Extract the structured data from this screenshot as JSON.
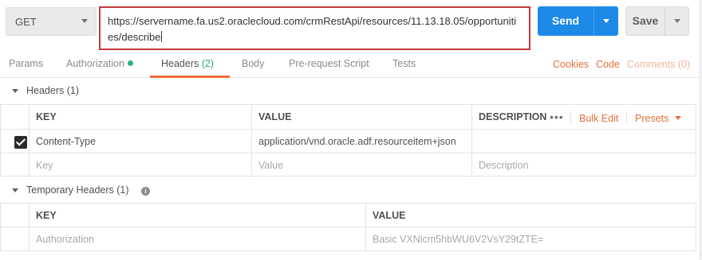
{
  "request": {
    "method": "GET",
    "url": "https://servername.fa.us2.oraclecloud.com/crmRestApi/resources/11.13.18.05/opportunities/describe",
    "send_label": "Send",
    "save_label": "Save"
  },
  "tabs": {
    "params": "Params",
    "authorization": "Authorization",
    "headers": "Headers",
    "headers_count": "(2)",
    "body": "Body",
    "pre_request": "Pre-request Script",
    "tests": "Tests",
    "cookies": "Cookies",
    "code": "Code",
    "comments": "Comments (0)"
  },
  "headers_section": {
    "title": "Headers (1)",
    "columns": {
      "key": "KEY",
      "value": "VALUE",
      "description": "DESCRIPTION"
    },
    "bulk_edit": "Bulk Edit",
    "presets": "Presets",
    "rows": [
      {
        "key": "Content-Type",
        "value": "application/vnd.oracle.adf.resourceitem+json",
        "description": "",
        "checked": true
      }
    ],
    "placeholder": {
      "key": "Key",
      "value": "Value",
      "description": "Description"
    }
  },
  "temp_headers_section": {
    "title": "Temporary Headers (1)",
    "columns": {
      "key": "KEY",
      "value": "VALUE"
    },
    "rows": [
      {
        "key": "Authorization",
        "value": "Basic VXNlcm5hbWU6V2VsY29tZTE="
      }
    ]
  },
  "colors": {
    "accent": "#f26b3a",
    "send_blue": "#1d8ae8",
    "url_border": "#c43a3a",
    "status_green": "#2fb380"
  },
  "icons": [
    "caret-down-icon",
    "status-dot-icon",
    "collapse-triangle-icon",
    "more-options-icon",
    "info-icon",
    "checkbox-checked-icon"
  ]
}
